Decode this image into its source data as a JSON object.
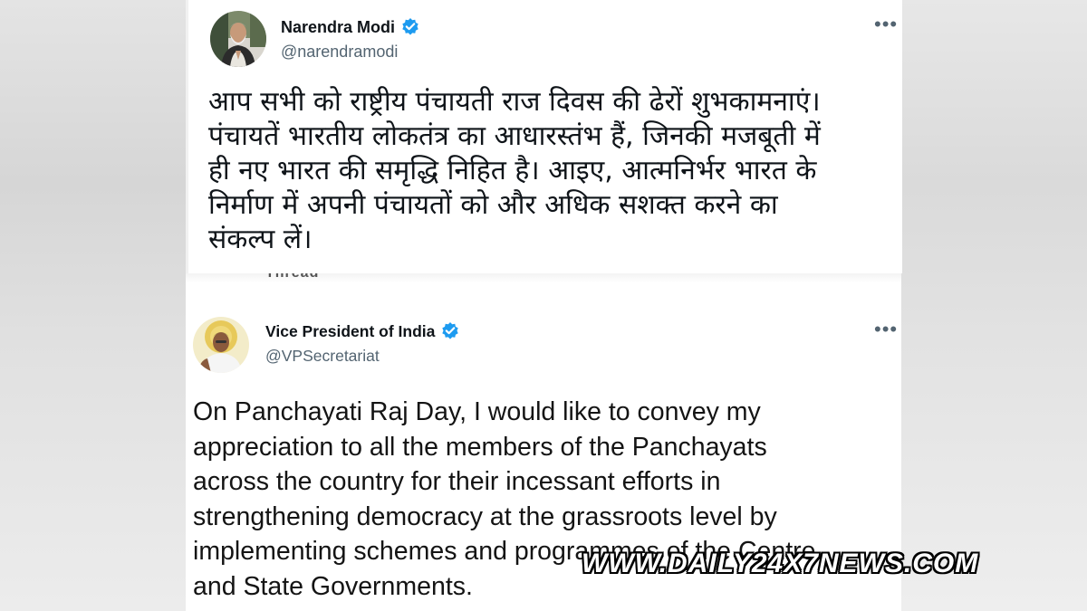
{
  "tweets": [
    {
      "author_name": "Narendra Modi",
      "handle": "@narendramodi",
      "verified": true,
      "text": "आप सभी को राष्ट्रीय पंचायती राज दिवस की ढेरों शुभकामनाएं।\nपंचायतें भारतीय लोकतंत्र का आधारस्तंभ हैं, जिनकी मजबूती में\nही नए भारत की समृद्धि निहित है। आइए, आत्मनिर्भर भारत के\nनिर्माण में अपनी पंचायतों को और अधिक सशक्त करने का\nसंकल्प लें।",
      "more_icon": "more-options-icon"
    },
    {
      "author_name": "Vice President of India",
      "handle": "@VPSecretariat",
      "verified": true,
      "text": "On Panchayati Raj Day, I would like to convey my\nappreciation to all the members of the Panchayats\nacross the country for their incessant efforts in\nstrengthening democracy at the grassroots level by\nimplementing schemes and programmes of the Centre\nand State Governments.",
      "more_icon": "more-options-icon"
    }
  ],
  "seam_text": "Thread",
  "watermark": "WWW.DAILY24X7NEWS.COM",
  "colors": {
    "verified_blue": "#1d9bf0",
    "text_primary": "#0f1419",
    "text_secondary": "#536471"
  }
}
